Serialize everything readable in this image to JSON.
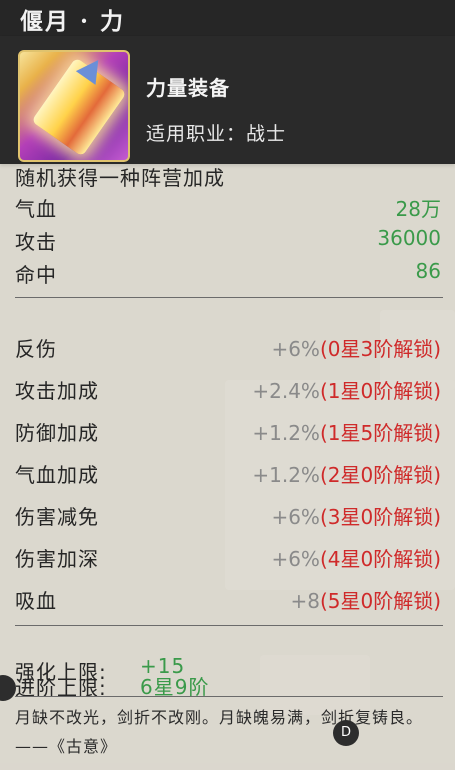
{
  "title": "偃月 · 力",
  "item": {
    "name": "力量装备",
    "class_label": "适用职业：战士"
  },
  "random_camp_text": "随机获得一种阵营加成",
  "base_stats": [
    {
      "name": "气血",
      "value": "28万"
    },
    {
      "name": "攻击",
      "value": "36000"
    },
    {
      "name": "命中",
      "value": "86"
    }
  ],
  "bonus_stats": [
    {
      "name": "反伤",
      "value": "+6%",
      "unlock": "(0星3阶解锁)"
    },
    {
      "name": "攻击加成",
      "value": "+2.4%",
      "unlock": "(1星0阶解锁)"
    },
    {
      "name": "防御加成",
      "value": "+1.2%",
      "unlock": "(1星5阶解锁)"
    },
    {
      "name": "气血加成",
      "value": "+1.2%",
      "unlock": "(2星0阶解锁)"
    },
    {
      "name": "伤害减免",
      "value": "+6%",
      "unlock": "(3星0阶解锁)"
    },
    {
      "name": "伤害加深",
      "value": "+6%",
      "unlock": "(4星0阶解锁)"
    },
    {
      "name": "吸血",
      "value": "+8",
      "unlock": "(5星0阶解锁)"
    }
  ],
  "limits": {
    "strengthen_label": "强化上限:",
    "strengthen_value": "+15",
    "advance_label": "进阶上限:",
    "advance_value": "6星9阶"
  },
  "motto": "月缺不改光，剑折不改刚。月缺魄易满，剑折复铸良。——《古意》",
  "overlay_button_label": "D",
  "colors": {
    "green": "#3a9a4a",
    "red": "#cf2a2a",
    "gray": "#8a8a8a"
  }
}
